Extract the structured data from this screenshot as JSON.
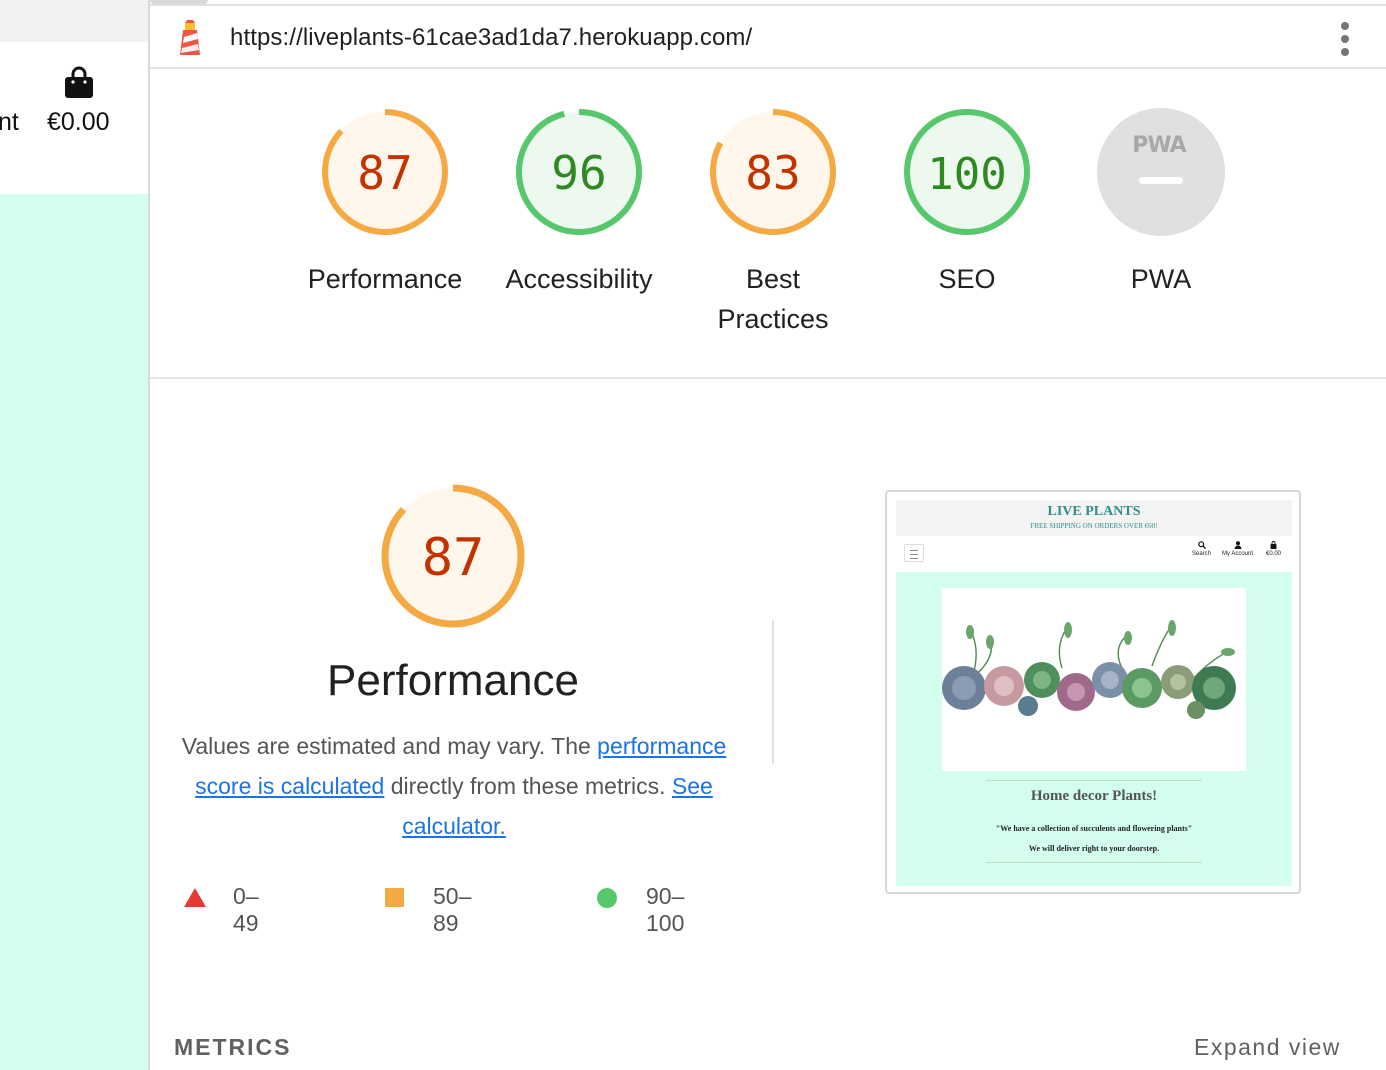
{
  "site": {
    "account_tail": "nt",
    "bag_icon": "shopping-bag-icon",
    "total": "€0.00",
    "accent_color": "#d3fdec"
  },
  "lighthouse": {
    "logo_icon": "lighthouse-icon",
    "url": "https://liveplants-61cae3ad1da7.herokuapp.com/",
    "menu_icon": "more-vertical-icon",
    "gauges": [
      {
        "label": "Performance",
        "score": "87",
        "value": 87,
        "status": "average"
      },
      {
        "label": "Accessibility",
        "score": "96",
        "value": 96,
        "status": "pass"
      },
      {
        "label": "Best Practices",
        "score": "83",
        "value": 83,
        "status": "average"
      },
      {
        "label": "SEO",
        "score": "100",
        "value": 100,
        "status": "pass"
      },
      {
        "label": "PWA",
        "score": "PWA",
        "value": null,
        "status": "na"
      }
    ],
    "colors": {
      "average_stroke": "#f4a942",
      "average_text": "#c33300",
      "average_fill": "#fff6ec",
      "pass_stroke": "#57c76c",
      "pass_text": "#2e8a20",
      "pass_fill": "#edf9ef",
      "fail": "#e53935",
      "na_fill": "#e0e0e0"
    },
    "performance": {
      "score": "87",
      "value": 87,
      "title": "Performance",
      "desc_1": "Values are estimated and may vary. The ",
      "link_1": "performance score is calculated",
      "desc_2": " directly from these metrics. ",
      "link_2": "See calculator."
    },
    "legend": [
      {
        "shape": "triangle",
        "range": "0–49"
      },
      {
        "shape": "square",
        "range": "50–89"
      },
      {
        "shape": "circle",
        "range": "90–100"
      }
    ],
    "screenshot": {
      "brand": "LIVE PLANTS",
      "shipping": "FREE SHIPPING ON ORDERS OVER €60!",
      "nav": [
        {
          "icon": "search-icon",
          "label": "Search"
        },
        {
          "icon": "user-icon",
          "label": "My Account"
        },
        {
          "icon": "shopping-bag-icon",
          "label": "€0.00"
        }
      ],
      "tagline": "Home decor Plants!",
      "quote_1": "\"We have a collection of succulents and flowering plants\"",
      "quote_2": "We will deliver right to your doorstep."
    },
    "metrics_label": "METRICS",
    "expand_label": "Expand view"
  }
}
